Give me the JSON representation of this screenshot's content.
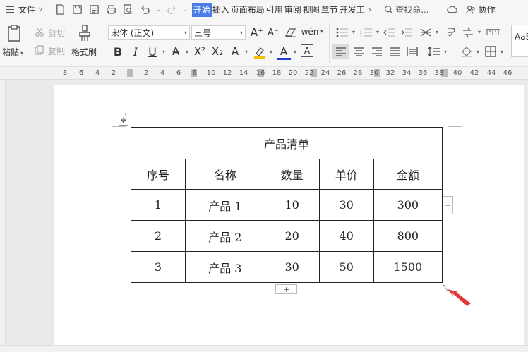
{
  "menubar": {
    "file_label": "文件",
    "tabs": [
      {
        "label": "开始",
        "active": true
      },
      {
        "label": "插入",
        "active": false
      },
      {
        "label": "页面布局",
        "active": false
      },
      {
        "label": "引用",
        "active": false
      },
      {
        "label": "审阅",
        "active": false
      },
      {
        "label": "视图",
        "active": false
      },
      {
        "label": "章节",
        "active": false
      },
      {
        "label": "开发工",
        "active": false
      }
    ],
    "search_label": "查找命...",
    "collab_label": "协作"
  },
  "ribbon": {
    "paste_label": "粘贴",
    "cut_label": "剪切",
    "copy_label": "复制",
    "format_painter_label": "格式刷",
    "font_name": "宋体 (正文)",
    "font_size": "三号",
    "styles_preview": "AaB"
  },
  "ruler": {
    "ticks": [
      "8",
      "6",
      "4",
      "2",
      "2",
      "4",
      "6",
      "8",
      "10",
      "12",
      "14",
      "16",
      "18",
      "20",
      "22",
      "24",
      "26",
      "28",
      "30",
      "32",
      "34",
      "36",
      "38",
      "40",
      "42",
      "44",
      "46"
    ]
  },
  "table": {
    "title": "产品清单",
    "headers": [
      "序号",
      "名称",
      "数量",
      "单价",
      "金额"
    ],
    "rows": [
      [
        "1",
        "产品 1",
        "10",
        "30",
        "300"
      ],
      [
        "2",
        "产品 2",
        "20",
        "40",
        "800"
      ],
      [
        "3",
        "产品 3",
        "30",
        "50",
        "1500"
      ]
    ]
  },
  "colors": {
    "active_tab": "#4a7ee6",
    "cursor_arrow": "#e23a3a",
    "font_color_underline": "#1f3fd1",
    "highlight_underline": "#f0c000"
  }
}
